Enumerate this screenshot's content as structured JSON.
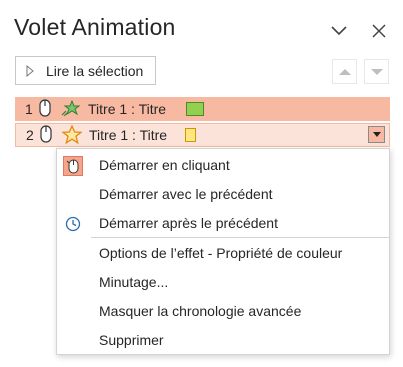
{
  "pane": {
    "title": "Volet Animation"
  },
  "header": {
    "collapse_icon": "chevron-down-icon",
    "close_icon": "close-icon"
  },
  "toolbar": {
    "play_label": "Lire la sélection",
    "move_up_icon": "triangle-up-icon",
    "move_down_icon": "triangle-down-icon"
  },
  "animations": [
    {
      "number": "1",
      "trigger_icon": "mouse-icon",
      "effect_icon": "star-sparkle-icon",
      "name": "Titre 1 : Titre",
      "bar_color": "#92d050",
      "selected": true
    },
    {
      "number": "2",
      "trigger_icon": "mouse-icon",
      "effect_icon": "star-outline-icon",
      "name": "Titre 1 : Titre",
      "bar_color": "#ffe680",
      "selected": false
    }
  ],
  "context_menu": {
    "items": [
      {
        "label": "Démarrer en cliquant",
        "icon": "mouse-icon",
        "checked": true
      },
      {
        "label": "Démarrer avec le précédent",
        "icon": null
      },
      {
        "label": "Démarrer après le précédent",
        "icon": "clock-icon"
      },
      {
        "label": "Options de l’effet - Propriété de couleur",
        "icon": null
      },
      {
        "label": "Minutage...",
        "icon": null
      },
      {
        "label": "Masquer la chronologie avancée",
        "icon": null
      },
      {
        "label": "Supprimer",
        "icon": null
      }
    ]
  },
  "colors": {
    "selected_row": "#f8b9a3",
    "hover_row": "#fbe3d9",
    "accent": "#e07a5f"
  }
}
